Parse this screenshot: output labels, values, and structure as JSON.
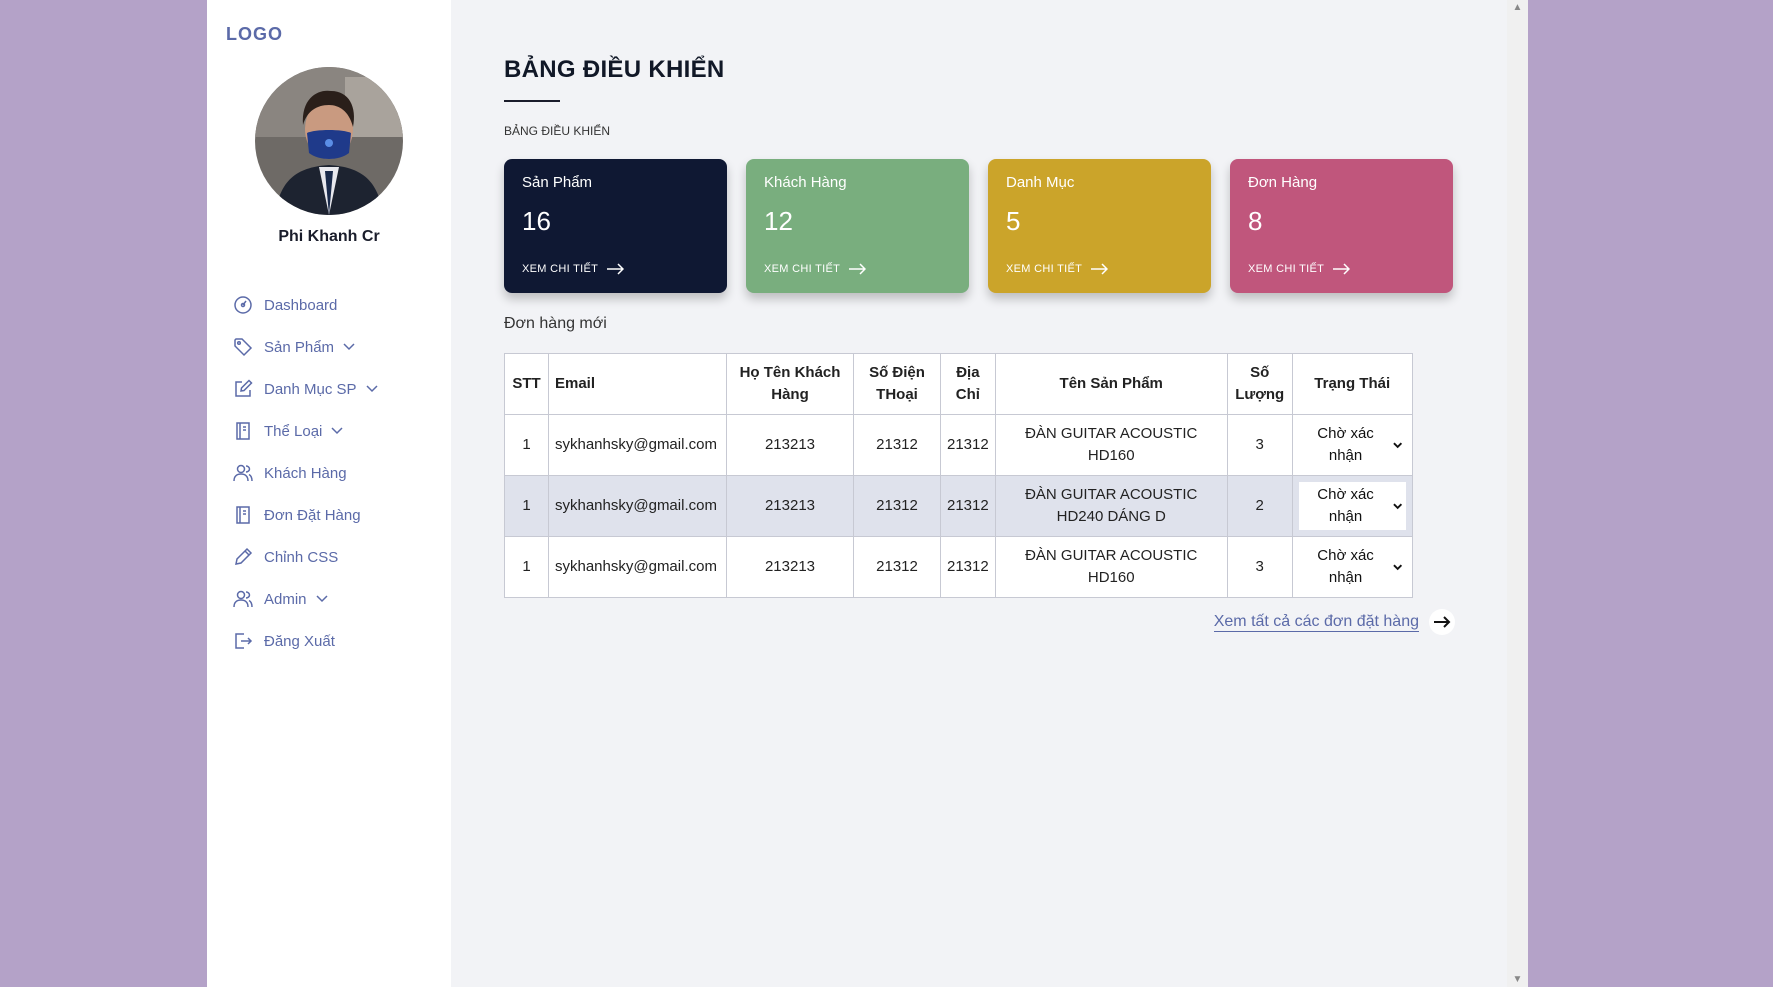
{
  "sidebar": {
    "logo": "LOGO",
    "user_name": "Phi Khanh Cr",
    "items": [
      {
        "label": "Dashboard"
      },
      {
        "label": "Sản Phẩm"
      },
      {
        "label": "Danh Mục SP"
      },
      {
        "label": "Thể Loại"
      },
      {
        "label": "Khách Hàng"
      },
      {
        "label": "Đơn Đặt Hàng"
      },
      {
        "label": "Chỉnh CSS"
      },
      {
        "label": "Admin"
      },
      {
        "label": "Đăng Xuất"
      }
    ]
  },
  "main": {
    "title": "BẢNG ĐIỀU KHIỂN",
    "breadcrumb": "BẢNG ĐIỀU KHIỂN",
    "cards": [
      {
        "label": "Sản Phẩm",
        "value": "16",
        "link": "XEM CHI TIẾT",
        "color": "#0f1833"
      },
      {
        "label": "Khách Hàng",
        "value": "12",
        "link": "XEM CHI TIẾT",
        "color": "#79ae7e"
      },
      {
        "label": "Danh Mục",
        "value": "5",
        "link": "XEM CHI TIẾT",
        "color": "#cba42a"
      },
      {
        "label": "Đơn Hàng",
        "value": "8",
        "link": "XEM CHI TIẾT",
        "color": "#c0567c"
      }
    ],
    "orders_title": "Đơn hàng mới",
    "table": {
      "headers": {
        "stt": "STT",
        "email": "Email",
        "name_1": "Họ Tên Khách",
        "name_2": "Hàng",
        "phone_1": "Số Điện",
        "phone_2": "THoại",
        "addr_1": "Địa",
        "addr_2": "Chỉ",
        "product": "Tên Sản Phẩm",
        "qty_1": "Số",
        "qty_2": "Lượng",
        "status": "Trạng Thái"
      },
      "rows": [
        {
          "stt": "1",
          "email": "sykhanhsky@gmail.com",
          "name": "213213",
          "phone": "21312",
          "address": "21312",
          "product_1": "ĐÀN GUITAR ACOUSTIC",
          "product_2": "HD160",
          "qty": "3",
          "status": "Chờ xác nhận"
        },
        {
          "stt": "1",
          "email": "sykhanhsky@gmail.com",
          "name": "213213",
          "phone": "21312",
          "address": "21312",
          "product_1": "ĐÀN GUITAR ACOUSTIC",
          "product_2": "HD240 DÁNG D",
          "qty": "2",
          "status": "Chờ xác nhận"
        },
        {
          "stt": "1",
          "email": "sykhanhsky@gmail.com",
          "name": "213213",
          "phone": "21312",
          "address": "21312",
          "product_1": "ĐÀN GUITAR ACOUSTIC",
          "product_2": "HD160",
          "qty": "3",
          "status": "Chờ xác nhận"
        }
      ]
    },
    "view_all": "Xem tất cả các đơn đặt hàng"
  }
}
